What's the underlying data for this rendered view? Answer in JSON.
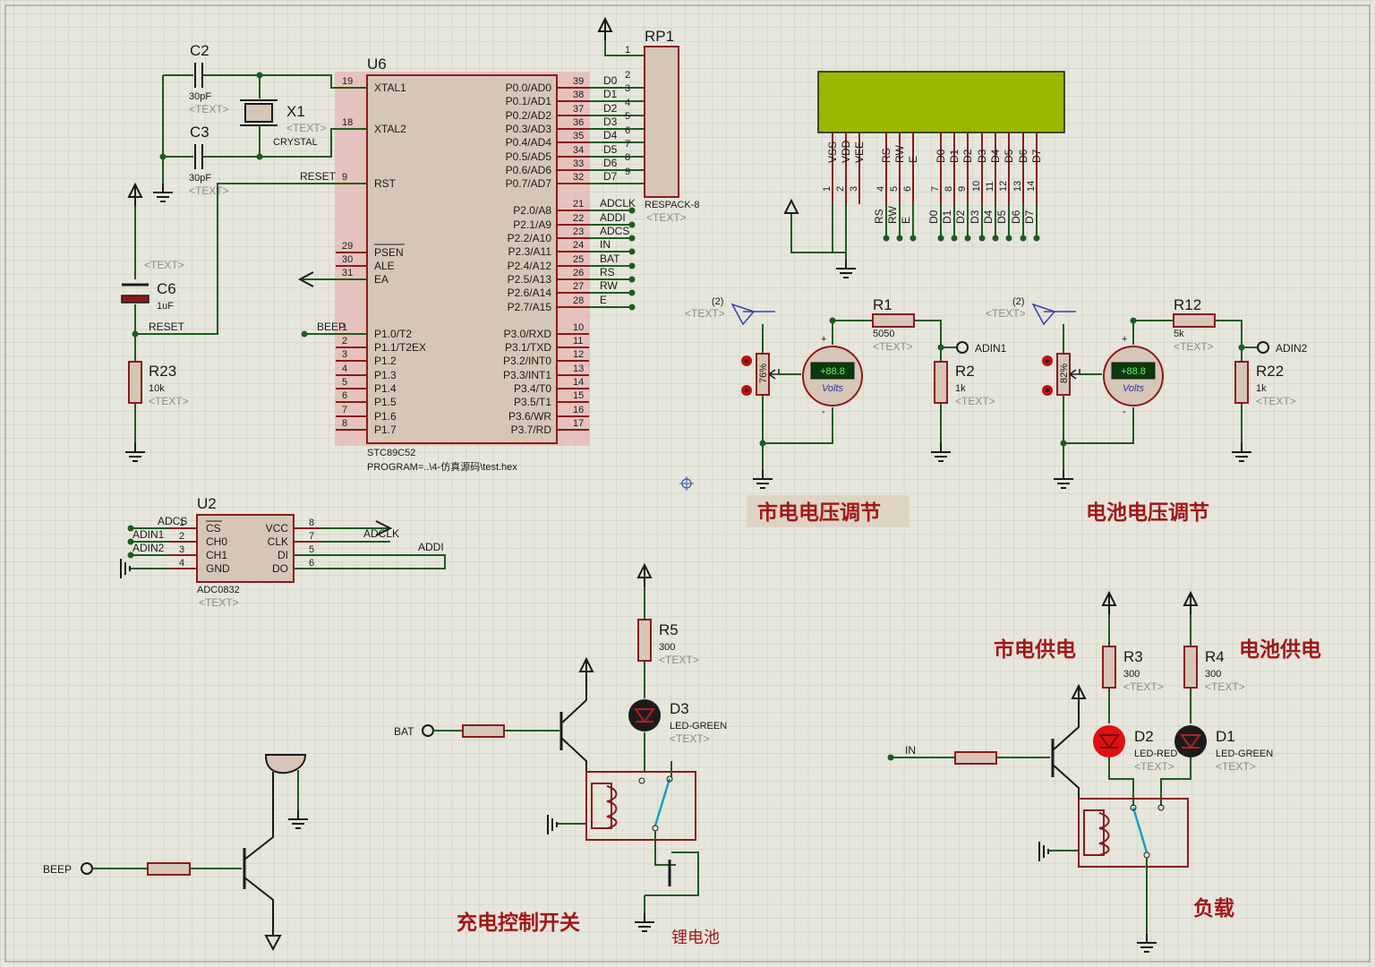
{
  "mcu": {
    "ref": "U6",
    "part": "STC89C52",
    "program": "PROGRAM=..\\4-仿真源码\\test.hex",
    "left_pins": [
      {
        "num": "19",
        "name": "XTAL1"
      },
      {
        "num": "18",
        "name": "XTAL2"
      },
      {
        "num": "9",
        "name": "RST"
      },
      {
        "num": "29",
        "name": "PSEN"
      },
      {
        "num": "30",
        "name": "ALE"
      },
      {
        "num": "31",
        "name": "EA"
      },
      {
        "num": "1",
        "name": "P1.0/T2"
      },
      {
        "num": "2",
        "name": "P1.1/T2EX"
      },
      {
        "num": "3",
        "name": "P1.2"
      },
      {
        "num": "4",
        "name": "P1.3"
      },
      {
        "num": "5",
        "name": "P1.4"
      },
      {
        "num": "6",
        "name": "P1.5"
      },
      {
        "num": "7",
        "name": "P1.6"
      },
      {
        "num": "8",
        "name": "P1.7"
      }
    ],
    "right_pins": [
      {
        "num": "39",
        "name": "P0.0/AD0",
        "net": "D0"
      },
      {
        "num": "38",
        "name": "P0.1/AD1",
        "net": "D1"
      },
      {
        "num": "37",
        "name": "P0.2/AD2",
        "net": "D2"
      },
      {
        "num": "36",
        "name": "P0.3/AD3",
        "net": "D3"
      },
      {
        "num": "35",
        "name": "P0.4/AD4",
        "net": "D4"
      },
      {
        "num": "34",
        "name": "P0.5/AD5",
        "net": "D5"
      },
      {
        "num": "33",
        "name": "P0.6/AD6",
        "net": "D6"
      },
      {
        "num": "32",
        "name": "P0.7/AD7",
        "net": "D7"
      },
      {
        "num": "21",
        "name": "P2.0/A8",
        "net": "ADCLK"
      },
      {
        "num": "22",
        "name": "P2.1/A9",
        "net": "ADDI"
      },
      {
        "num": "23",
        "name": "P2.2/A10",
        "net": "ADCS"
      },
      {
        "num": "24",
        "name": "P2.3/A11",
        "net": "IN"
      },
      {
        "num": "25",
        "name": "P2.4/A12",
        "net": "BAT"
      },
      {
        "num": "26",
        "name": "P2.5/A13",
        "net": "RS"
      },
      {
        "num": "27",
        "name": "P2.6/A14",
        "net": "RW"
      },
      {
        "num": "28",
        "name": "P2.7/A15",
        "net": "E"
      },
      {
        "num": "10",
        "name": "P3.0/RXD",
        "net": ""
      },
      {
        "num": "11",
        "name": "P3.1/TXD",
        "net": ""
      },
      {
        "num": "12",
        "name": "P3.2/INT0",
        "net": ""
      },
      {
        "num": "13",
        "name": "P3.3/INT1",
        "net": ""
      },
      {
        "num": "14",
        "name": "P3.4/T0",
        "net": ""
      },
      {
        "num": "15",
        "name": "P3.5/T1",
        "net": ""
      },
      {
        "num": "16",
        "name": "P3.6/WR",
        "net": ""
      },
      {
        "num": "17",
        "name": "P3.7/RD",
        "net": ""
      }
    ],
    "net_reset": "RESET",
    "net_beep": "BEEP"
  },
  "rp1": {
    "ref": "RP1",
    "part": "RESPACK-8",
    "pins": [
      "1",
      "2",
      "3",
      "4",
      "5",
      "6",
      "7",
      "8",
      "9"
    ]
  },
  "osc": {
    "c2_ref": "C2",
    "c2_val": "30pF",
    "c3_ref": "C3",
    "c3_val": "30pF",
    "x1_ref": "X1",
    "x1_val": "CRYSTAL"
  },
  "reset_circuit": {
    "c6_ref": "C6",
    "c6_val": "1uF",
    "r23_ref": "R23",
    "r23_val": "10k",
    "net": "RESET"
  },
  "lcd": {
    "pins": [
      {
        "name": "VSS",
        "num": "1"
      },
      {
        "name": "VDD",
        "num": "2"
      },
      {
        "name": "VEE",
        "num": "3"
      },
      {
        "name": "RS",
        "num": "4"
      },
      {
        "name": "RW",
        "num": "5"
      },
      {
        "name": "E",
        "num": "6"
      },
      {
        "name": "D0",
        "num": "7"
      },
      {
        "name": "D1",
        "num": "8"
      },
      {
        "name": "D2",
        "num": "9"
      },
      {
        "name": "D3",
        "num": "10"
      },
      {
        "name": "D4",
        "num": "11"
      },
      {
        "name": "D5",
        "num": "12"
      },
      {
        "name": "D6",
        "num": "13"
      },
      {
        "name": "D7",
        "num": "14"
      }
    ],
    "bus_labels": [
      "RS",
      "RW",
      "E",
      "D0",
      "D1",
      "D2",
      "D3",
      "D4",
      "D5",
      "D6",
      "D7"
    ]
  },
  "adc": {
    "ref": "U2",
    "part": "ADC0832",
    "left_pins": [
      {
        "num": "1",
        "name": "CS",
        "net": "ADCS"
      },
      {
        "num": "2",
        "name": "CH0",
        "net": "ADIN1"
      },
      {
        "num": "3",
        "name": "CH1",
        "net": "ADIN2"
      },
      {
        "num": "4",
        "name": "GND",
        "net": ""
      }
    ],
    "right_pins": [
      {
        "num": "8",
        "name": "VCC",
        "net": ""
      },
      {
        "num": "7",
        "name": "CLK",
        "net": "ADCLK"
      },
      {
        "num": "5",
        "name": "DI",
        "net": "ADDI"
      },
      {
        "num": "6",
        "name": "DO",
        "net": ""
      }
    ]
  },
  "mains_adj": {
    "title": "市电电压调节",
    "pot_pct": "76%",
    "pot_pin": "(2)",
    "r1_ref": "R1",
    "r1_val": "5050",
    "r2_ref": "R2",
    "r2_val": "1k",
    "net": "ADIN1",
    "meter_reading": "+88.8",
    "meter_unit": "Volts"
  },
  "battery_adj": {
    "title": "电池电压调节",
    "pot_pct": "82%",
    "pot_pin": "(2)",
    "r12_ref": "R12",
    "r12_val": "5k",
    "r22_ref": "R22",
    "r22_val": "1k",
    "net": "ADIN2",
    "meter_reading": "+88.8",
    "meter_unit": "Volts"
  },
  "charge_ctrl": {
    "title": "充电控制开关",
    "input": "BAT",
    "r5_ref": "R5",
    "r5_val": "300",
    "d3_ref": "D3",
    "d3_val": "LED-GREEN",
    "battery_label": "锂电池"
  },
  "supply": {
    "mains_label": "市电供电",
    "battery_label": "电池供电",
    "load_label": "负载",
    "input": "IN",
    "r3_ref": "R3",
    "r3_val": "300",
    "r4_ref": "R4",
    "r4_val": "300",
    "d2_ref": "D2",
    "d2_val": "LED-RED",
    "d1_ref": "D1",
    "d1_val": "LED-GREEN"
  },
  "buzzer": {
    "input": "BEEP"
  },
  "placeholder_text": "<TEXT>",
  "colors": {
    "background": "#e7e6dc",
    "grid": "#c9c8bd",
    "wire": "#1d5c1d",
    "component": "#8b1a1a",
    "body_fill": "#d6c6b8",
    "lcd": "#9ab800",
    "cn_label": "#a01818",
    "led_red": "#e01010",
    "led_off": "#1c1c1c"
  }
}
